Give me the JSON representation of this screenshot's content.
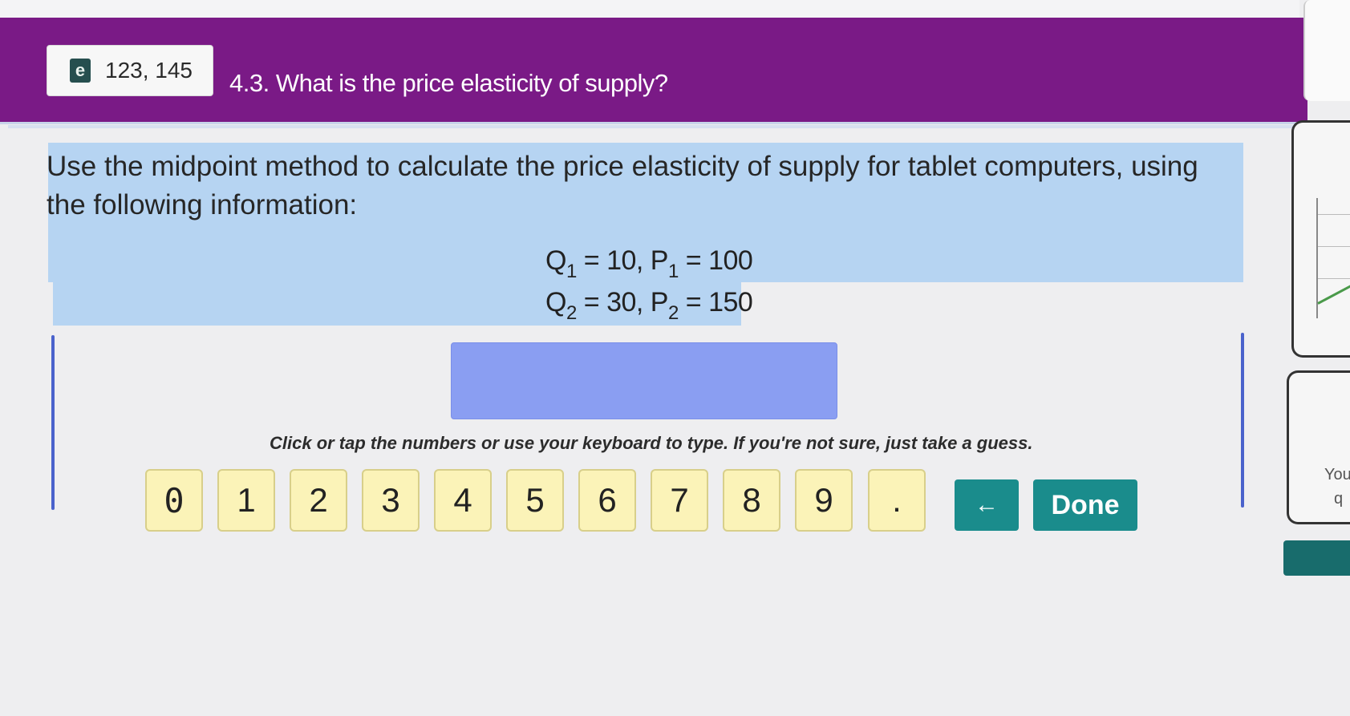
{
  "header": {
    "ref_pages": "123, 145",
    "ebook_icon_glyph": "e",
    "question_title": "4.3. What is the price elasticity of supply?"
  },
  "prompt": {
    "text": "Use the midpoint method to calculate the price elasticity of supply for tablet computers, using the following information:",
    "eq1": {
      "q_label": "Q",
      "q_sub": "1",
      "q_value": "= 10, ",
      "p_label": "P",
      "p_sub": "1",
      "p_value": "= 100"
    },
    "eq2": {
      "q_label": "Q",
      "q_sub": "2",
      "q_value": "= 30, ",
      "p_label": "P",
      "p_sub": "2",
      "p_value": "= 150"
    }
  },
  "answer": {
    "value": ""
  },
  "instructions": "Click or tap the numbers or use your keyboard to type. If you're not sure, just take a guess.",
  "keypad": {
    "keys": [
      "0",
      "1",
      "2",
      "3",
      "4",
      "5",
      "6",
      "7",
      "8",
      "9",
      "."
    ],
    "backspace_glyph": "←",
    "done_label": "Done"
  },
  "side": {
    "text_line1": "You",
    "text_line2": "q"
  },
  "colors": {
    "header": "#7a1a86",
    "highlight": "#b6d4f2",
    "answer_box": "#8a9ef2",
    "key": "#fbf3b8",
    "accent": "#1a8c8c"
  },
  "icons": [
    "ebook-icon",
    "backspace-arrow-icon"
  ]
}
